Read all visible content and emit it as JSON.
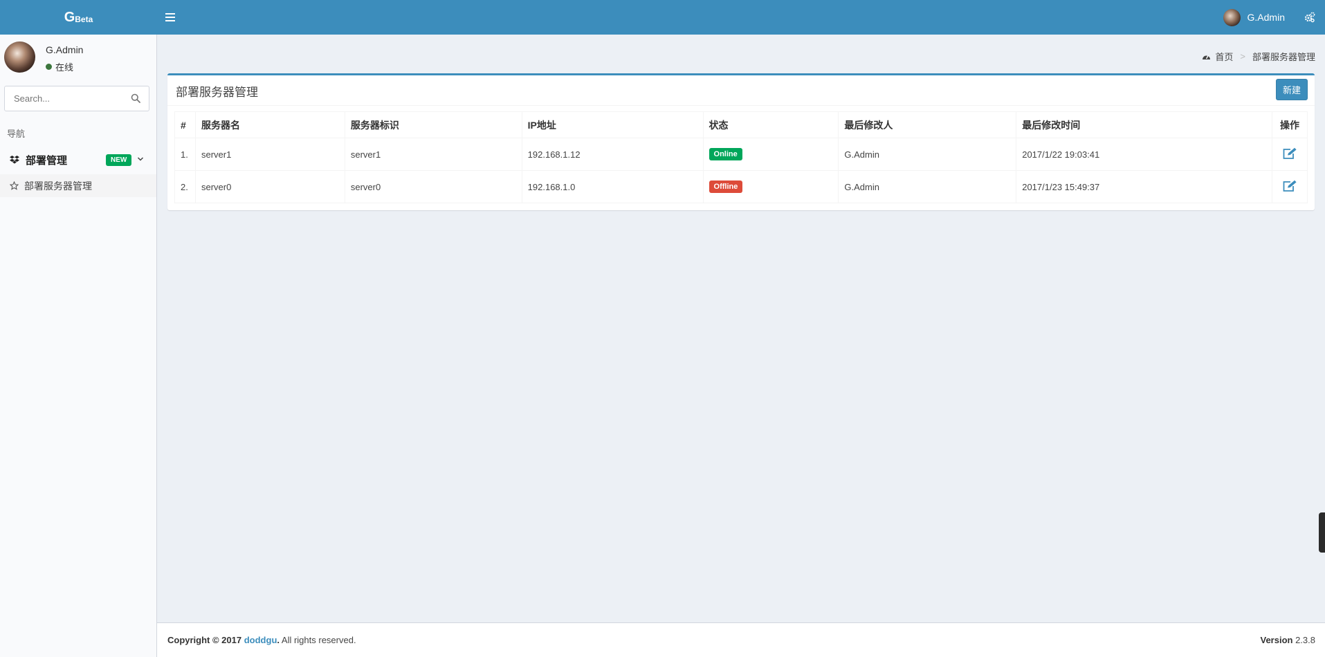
{
  "header": {
    "logo_main": "G",
    "logo_sub": "Beta",
    "username": "G.Admin"
  },
  "sidebar": {
    "user": {
      "name": "G.Admin",
      "status": "在线"
    },
    "search": {
      "placeholder": "Search..."
    },
    "nav_header": "导航",
    "menu": {
      "label": "部署管理",
      "badge": "NEW",
      "subitems": [
        {
          "label": "部署服务器管理"
        }
      ]
    }
  },
  "breadcrumb": {
    "home": "首页",
    "current": "部署服务器管理"
  },
  "box": {
    "title": "部署服务器管理",
    "new_button": "新建"
  },
  "table": {
    "columns": [
      "#",
      "服务器名",
      "服务器标识",
      "IP地址",
      "状态",
      "最后修改人",
      "最后修改时间",
      "操作"
    ],
    "rows": [
      {
        "idx": "1.",
        "name": "server1",
        "id": "server1",
        "ip": "192.168.1.12",
        "status": "Online",
        "modifier": "G.Admin",
        "modified": "2017/1/22 19:03:41"
      },
      {
        "idx": "2.",
        "name": "server0",
        "id": "server0",
        "ip": "192.168.1.0",
        "status": "Offline",
        "modifier": "G.Admin",
        "modified": "2017/1/23 15:49:37"
      }
    ]
  },
  "footer": {
    "copyright_prefix": "Copyright © 2017",
    "link": "doddgu",
    "dot": ".",
    "suffix": " All rights reserved.",
    "version_label": "Version",
    "version": "2.3.8"
  },
  "colors": {
    "primary": "#3c8dbc",
    "success": "#00a65a",
    "danger": "#dd4b39",
    "background": "#ecf0f5"
  },
  "icons": [
    "menu-icon",
    "gear-icon",
    "search-icon",
    "dropbox-icon",
    "chevron-down-icon",
    "star-icon",
    "dashboard-icon",
    "edit-icon"
  ]
}
